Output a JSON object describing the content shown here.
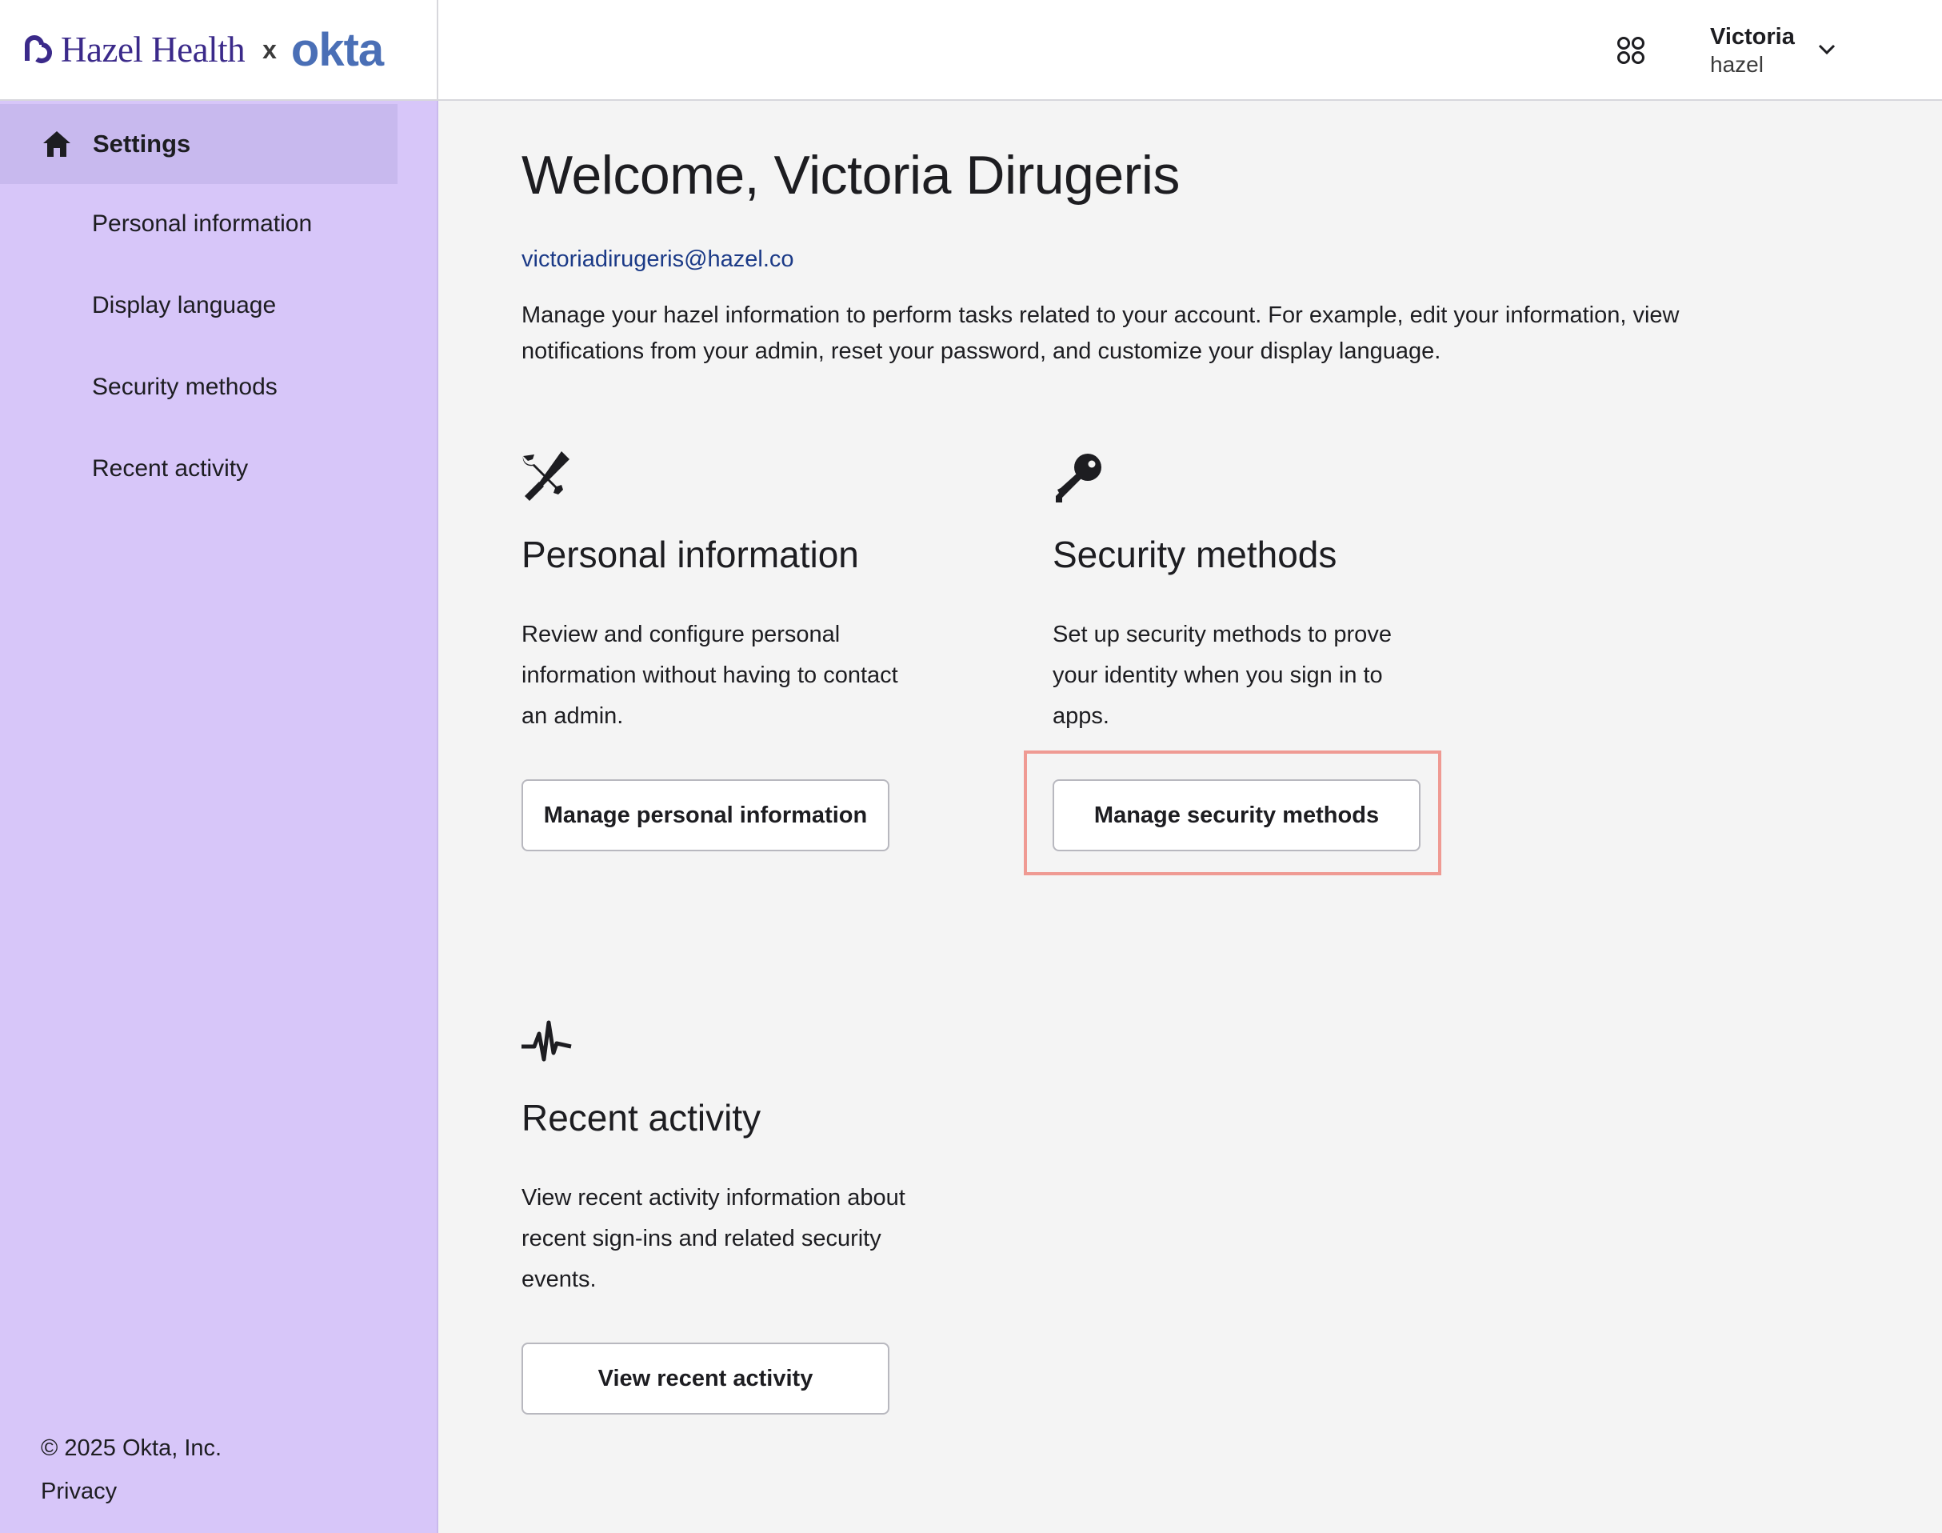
{
  "brand": {
    "hazel": "Hazel Health",
    "separator": "x",
    "okta": "okta"
  },
  "header": {
    "user_name": "Victoria",
    "user_org": "hazel"
  },
  "sidebar": {
    "settings_label": "Settings",
    "items": [
      {
        "label": "Personal information"
      },
      {
        "label": "Display language"
      },
      {
        "label": "Security methods"
      },
      {
        "label": "Recent activity"
      }
    ],
    "footer_copyright": "© 2025 Okta, Inc.",
    "footer_privacy": "Privacy"
  },
  "main": {
    "title": "Welcome, Victoria Dirugeris",
    "email": "victoriadirugeris@hazel.co",
    "intro": "Manage your hazel information to perform tasks related to your account. For example, edit your information, view notifications from your admin, reset your password, and customize your display language.",
    "cards": [
      {
        "icon": "tools-icon",
        "title": "Personal information",
        "description": "Review and configure personal information without having to contact an admin.",
        "button": "Manage personal information"
      },
      {
        "icon": "key-icon",
        "title": "Security methods",
        "description": "Set up security methods to prove your identity when you sign in to apps.",
        "button": "Manage security methods"
      },
      {
        "icon": "activity-icon",
        "title": "Recent activity",
        "description": "View recent activity information about recent sign-ins and related security events.",
        "button": "View recent activity"
      }
    ]
  },
  "colors": {
    "sidebar_bg": "#d7c6f9",
    "sidebar_active": "#c8b9ee",
    "brand_hazel": "#3b2a8a",
    "brand_okta": "#4a6fb6",
    "highlight": "#ef9a93"
  }
}
